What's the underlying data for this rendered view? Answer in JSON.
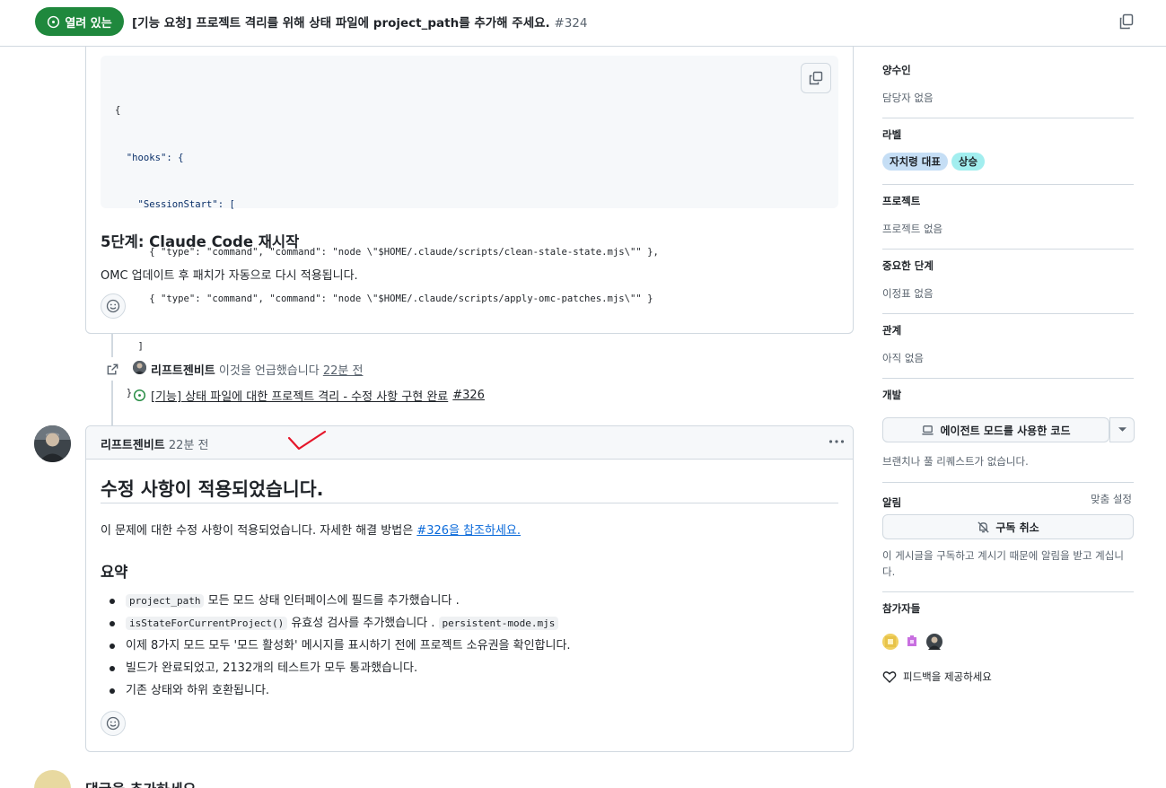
{
  "header": {
    "state_label": "열려 있는",
    "title": "[기능 요청] 프로젝트 격리를 위해 상태 파일에 project_path를 추가해 주세요.",
    "number": "#324"
  },
  "comment1": {
    "code_lines": [
      "{",
      "  \"hooks\": {",
      "    \"SessionStart\": [",
      "      { \"type\": \"command\", \"command\": \"node \\\"$HOME/.claude/scripts/clean-stale-state.mjs\\\"\" },",
      "      { \"type\": \"command\", \"command\": \"node \\\"$HOME/.claude/scripts/apply-omc-patches.mjs\\\"\" }",
      "    ]",
      "  }",
      "}"
    ],
    "heading": "5단계: Claude Code 재시작",
    "paragraph": "OMC 업데이트 후 패치가 자동으로 다시 적용됩니다."
  },
  "timeline": {
    "author": "리프트젠비트",
    "action": "이것을 언급했습니다",
    "time": "22분 전",
    "ref_title": "[기능] 상태 파일에 대한 프로젝트 격리 - 수정 사항 구현 완료",
    "ref_number": "#326"
  },
  "comment2": {
    "author": "리프트젠비트",
    "time": "22분 전",
    "heading": "수정 사항이 적용되었습니다.",
    "para_prefix": "이 문제에 대한 수정 사항이 적용되었습니다. 자세한 해결 방법은",
    "para_link": "#326을 참조하세요.",
    "summary_heading": "요약",
    "items": {
      "i1_code": "project_path",
      "i1_text": "모든 모드 상태 인터페이스에 필드를 추가했습니다 .",
      "i2_code": "isStateForCurrentProject()",
      "i2_text": "유효성 검사를 추가했습니다 .",
      "i2_code2": "persistent-mode.mjs",
      "i3": "이제 8가지 모드 모두 '모드 활성화' 메시지를 표시하기 전에 프로젝트 소유권을 확인합니다.",
      "i4": "빌드가 완료되었고, 2132개의 테스트가 모두 통과했습니다.",
      "i5": "기존 상태와 하위 호환됩니다."
    }
  },
  "bottom": {
    "text": "댓글을 추가하세요"
  },
  "sidebar": {
    "assignees_h": "양수인",
    "assignees_v": "담당자 없음",
    "labels_h": "라벨",
    "label1": "자치령 대표",
    "label1_color": "#c5def5",
    "label2": "상승",
    "label2_color": "#a2eeef",
    "projects_h": "프로젝트",
    "projects_v": "프로젝트 없음",
    "milestone_h": "중요한 단계",
    "milestone_v": "이정표 없음",
    "relations_h": "관계",
    "relations_v": "아직 없음",
    "dev_h": "개발",
    "dev_button": "에이전트 모드를 사용한 코드",
    "dev_note": "브랜치나 풀 리퀘스트가 없습니다.",
    "notif_h": "알림",
    "notif_custom": "맞춤 설정",
    "unsubscribe": "구독 취소",
    "notif_note_1": "이 게시글을 구독하고 계시기 때문에 알림을 받고 계십니",
    "notif_note_2": "다.",
    "participants_h": "참가자들",
    "feedback": "피드백을 제공하세요"
  },
  "accent_green": "#1f883d",
  "link_blue": "#0969da"
}
